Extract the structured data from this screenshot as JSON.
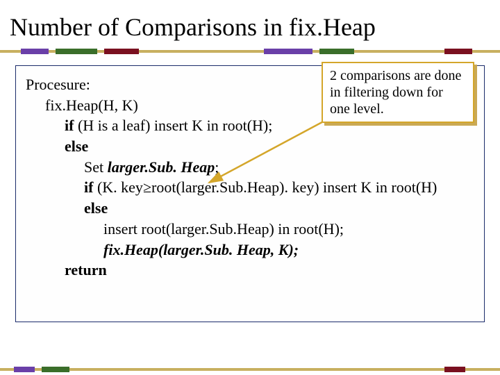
{
  "title": "Number of Comparisons in fix.Heap",
  "callout": "2 comparisons are done in filtering down for one level.",
  "code": {
    "l0": "Procesure:",
    "l1": "fix.Heap(H, K)",
    "l2a": "if",
    "l2b": " (H is a leaf) insert K in root(H);",
    "l3": "else",
    "l4a": "Set ",
    "l4b": "larger.Sub. Heap",
    "l4c": ";",
    "l5a": "if",
    "l5b": " (K. key",
    "l5sym": "≥",
    "l5c": "root(larger.Sub.Heap). key) insert K in root(H)",
    "l6": "else",
    "l7": "insert root(larger.Sub.Heap) in root(H);",
    "l8": "fix.Heap(larger.Sub. Heap, K);",
    "l9": "return"
  }
}
